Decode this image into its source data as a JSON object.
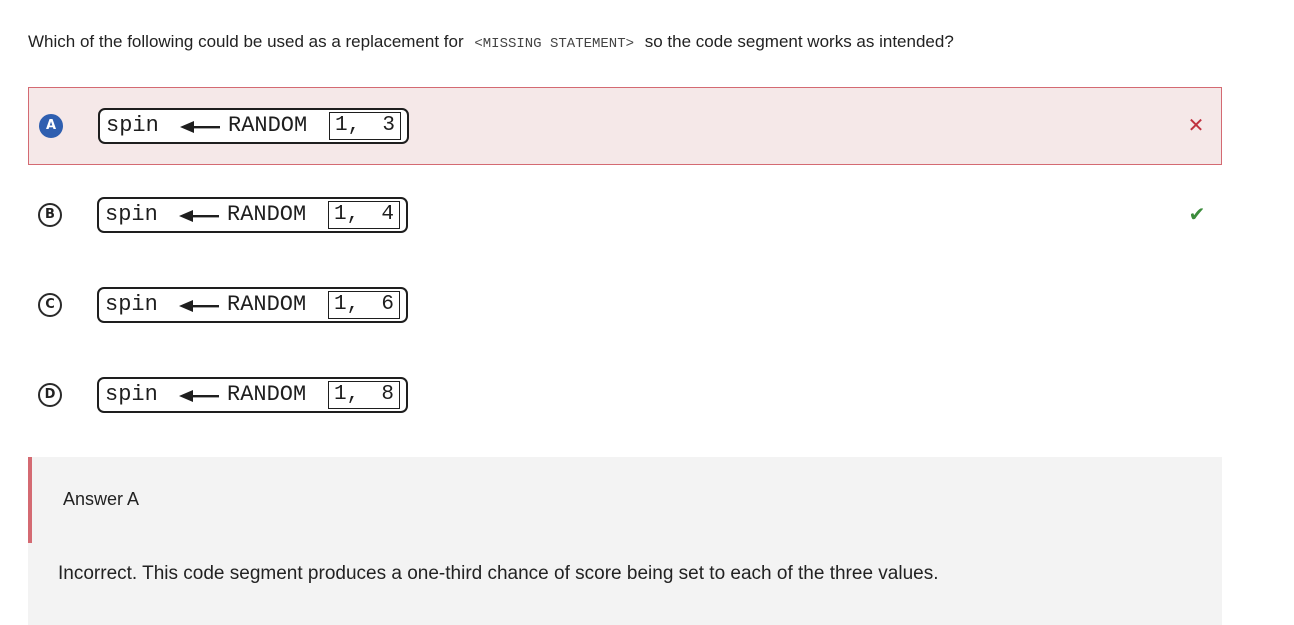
{
  "question": {
    "prefix": "Which of the following could be used as a replacement for",
    "code": "<MISSING STATEMENT>",
    "suffix": "so the code segment works as intended?"
  },
  "options": [
    {
      "letter": "A",
      "var": "spin",
      "proc": "RANDOM",
      "arg1": "1,",
      "arg2": "3",
      "state": "selected-incorrect",
      "status_icon": "x-icon"
    },
    {
      "letter": "B",
      "var": "spin",
      "proc": "RANDOM",
      "arg1": "1,",
      "arg2": "4",
      "state": "correct",
      "status_icon": "check-icon"
    },
    {
      "letter": "C",
      "var": "spin",
      "proc": "RANDOM",
      "arg1": "1,",
      "arg2": "6",
      "state": "none",
      "status_icon": ""
    },
    {
      "letter": "D",
      "var": "spin",
      "proc": "RANDOM",
      "arg1": "1,",
      "arg2": "8",
      "state": "none",
      "status_icon": ""
    }
  ],
  "feedback": {
    "answer_label": "Answer A",
    "explanation": "Incorrect. This code segment produces a one-third chance of score being set to each of the three values."
  },
  "colors": {
    "incorrect": "#c0323f",
    "correct": "#3c8c3c",
    "selected_letter": "#2f5fb0",
    "selected_bg": "#f5e8e8"
  }
}
